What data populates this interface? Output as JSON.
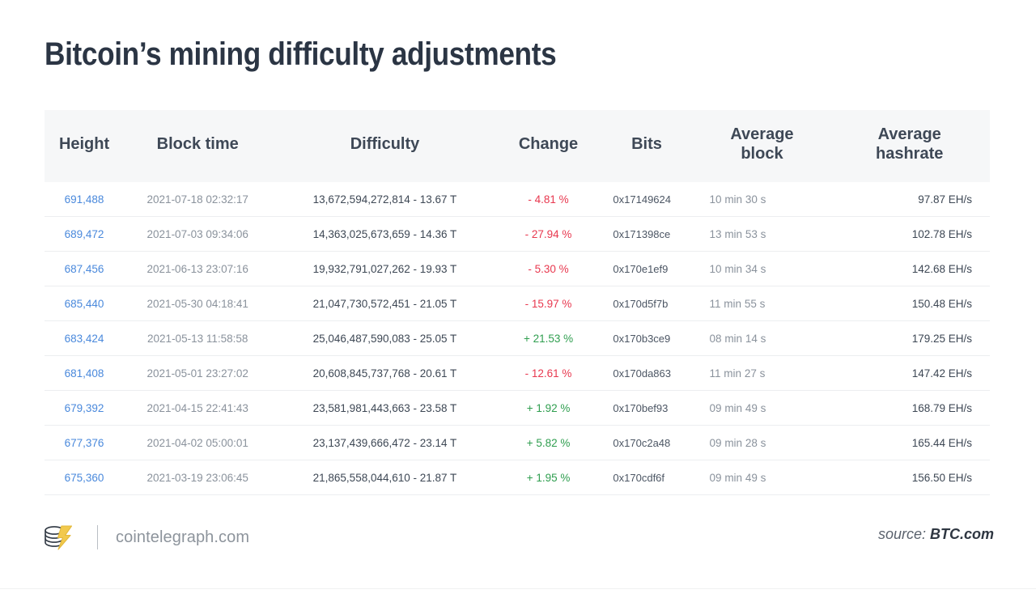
{
  "title": "Bitcoin’s mining difficulty adjustments",
  "colors": {
    "positive": "#2f9e4f",
    "negative": "#e8384f",
    "link": "#4a89dc",
    "header_bg": "#f6f7f8",
    "text": "#3d4754",
    "muted": "#8a929c",
    "logo_bolt": "#f2c94c"
  },
  "table": {
    "columns": [
      {
        "key": "height",
        "label": "Height"
      },
      {
        "key": "time",
        "label": "Block time"
      },
      {
        "key": "diff",
        "label": "Difficulty"
      },
      {
        "key": "change",
        "label": "Change"
      },
      {
        "key": "bits",
        "label": "Bits"
      },
      {
        "key": "avgblock",
        "label": "Average\nblock"
      },
      {
        "key": "hashrate",
        "label": "Average\nhashrate"
      }
    ],
    "column_labels": {
      "height": "Height",
      "time": "Block time",
      "difficulty": "Difficulty",
      "change": "Change",
      "bits": "Bits",
      "average_block_line1": "Average",
      "average_block_line2": "block",
      "average_hashrate_line1": "Average",
      "average_hashrate_line2": "hashrate"
    },
    "rows": [
      {
        "height": "691,488",
        "time": "2021-07-18 02:32:17",
        "difficulty": "13,672,594,272,814 - 13.67 T",
        "change": "- 4.81 %",
        "change_sign": "neg",
        "bits": "0x17149624",
        "average_block": "10 min 30 s",
        "average_hashrate": "97.87 EH/s"
      },
      {
        "height": "689,472",
        "time": "2021-07-03 09:34:06",
        "difficulty": "14,363,025,673,659 - 14.36 T",
        "change": "- 27.94 %",
        "change_sign": "neg",
        "bits": "0x171398ce",
        "average_block": "13 min 53 s",
        "average_hashrate": "102.78 EH/s"
      },
      {
        "height": "687,456",
        "time": "2021-06-13 23:07:16",
        "difficulty": "19,932,791,027,262 - 19.93 T",
        "change": "- 5.30 %",
        "change_sign": "neg",
        "bits": "0x170e1ef9",
        "average_block": "10 min 34 s",
        "average_hashrate": "142.68 EH/s"
      },
      {
        "height": "685,440",
        "time": "2021-05-30 04:18:41",
        "difficulty": "21,047,730,572,451 - 21.05 T",
        "change": "- 15.97 %",
        "change_sign": "neg",
        "bits": "0x170d5f7b",
        "average_block": "11 min 55 s",
        "average_hashrate": "150.48 EH/s"
      },
      {
        "height": "683,424",
        "time": "2021-05-13 11:58:58",
        "difficulty": "25,046,487,590,083 - 25.05 T",
        "change": "+ 21.53 %",
        "change_sign": "pos",
        "bits": "0x170b3ce9",
        "average_block": "08 min 14 s",
        "average_hashrate": "179.25 EH/s"
      },
      {
        "height": "681,408",
        "time": "2021-05-01 23:27:02",
        "difficulty": "20,608,845,737,768 - 20.61 T",
        "change": "- 12.61 %",
        "change_sign": "neg",
        "bits": "0x170da863",
        "average_block": "11 min 27 s",
        "average_hashrate": "147.42 EH/s"
      },
      {
        "height": "679,392",
        "time": "2021-04-15 22:41:43",
        "difficulty": "23,581,981,443,663 - 23.58 T",
        "change": "+ 1.92 %",
        "change_sign": "pos",
        "bits": "0x170bef93",
        "average_block": "09 min 49 s",
        "average_hashrate": "168.79 EH/s"
      },
      {
        "height": "677,376",
        "time": "2021-04-02 05:00:01",
        "difficulty": "23,137,439,666,472 - 23.14 T",
        "change": "+ 5.82 %",
        "change_sign": "pos",
        "bits": "0x170c2a48",
        "average_block": "09 min 28 s",
        "average_hashrate": "165.44 EH/s"
      },
      {
        "height": "675,360",
        "time": "2021-03-19 23:06:45",
        "difficulty": "21,865,558,044,610 - 21.87 T",
        "change": "+ 1.95 %",
        "change_sign": "pos",
        "bits": "0x170cdf6f",
        "average_block": "09 min 49 s",
        "average_hashrate": "156.50 EH/s"
      }
    ]
  },
  "footer": {
    "logo_icon": "coin-stack-lightning-icon",
    "brand_name": "cointelegraph.com",
    "source_label": "source:",
    "source_value": "BTC.com"
  },
  "chart_data": {
    "type": "table",
    "title": "Bitcoin’s mining difficulty adjustments",
    "columns": [
      "Height",
      "Block time",
      "Difficulty",
      "Change",
      "Bits",
      "Average block",
      "Average hashrate"
    ],
    "rows": [
      [
        "691,488",
        "2021-07-18 02:32:17",
        "13,672,594,272,814 - 13.67 T",
        "- 4.81 %",
        "0x17149624",
        "10 min 30 s",
        "97.87 EH/s"
      ],
      [
        "689,472",
        "2021-07-03 09:34:06",
        "14,363,025,673,659 - 14.36 T",
        "- 27.94 %",
        "0x171398ce",
        "13 min 53 s",
        "102.78 EH/s"
      ],
      [
        "687,456",
        "2021-06-13 23:07:16",
        "19,932,791,027,262 - 19.93 T",
        "- 5.30 %",
        "0x170e1ef9",
        "10 min 34 s",
        "142.68 EH/s"
      ],
      [
        "685,440",
        "2021-05-30 04:18:41",
        "21,047,730,572,451 - 21.05 T",
        "- 15.97 %",
        "0x170d5f7b",
        "11 min 55 s",
        "150.48 EH/s"
      ],
      [
        "683,424",
        "2021-05-13 11:58:58",
        "25,046,487,590,083 - 25.05 T",
        "+ 21.53 %",
        "0x170b3ce9",
        "08 min 14 s",
        "179.25 EH/s"
      ],
      [
        "681,408",
        "2021-05-01 23:27:02",
        "20,608,845,737,768 - 20.61 T",
        "- 12.61 %",
        "0x170da863",
        "11 min 27 s",
        "147.42 EH/s"
      ],
      [
        "679,392",
        "2021-04-15 22:41:43",
        "23,581,981,443,663 - 23.58 T",
        "+ 1.92 %",
        "0x170bef93",
        "09 min 49 s",
        "168.79 EH/s"
      ],
      [
        "677,376",
        "2021-04-02 05:00:01",
        "23,137,439,666,472 - 23.14 T",
        "+ 5.82 %",
        "0x170c2a48",
        "09 min 28 s",
        "165.44 EH/s"
      ],
      [
        "675,360",
        "2021-03-19 23:06:45",
        "21,865,558,044,610 - 21.87 T",
        "+ 1.95 %",
        "0x170cdf6f",
        "09 min 49 s",
        "156.50 EH/s"
      ]
    ],
    "difficulty_T": [
      13.67,
      14.36,
      19.93,
      21.05,
      25.05,
      20.61,
      23.58,
      23.14,
      21.87
    ],
    "change_pct": [
      -4.81,
      -27.94,
      -5.3,
      -15.97,
      21.53,
      -12.61,
      1.92,
      5.82,
      1.95
    ],
    "hashrate_EHs": [
      97.87,
      102.78,
      142.68,
      150.48,
      179.25,
      147.42,
      168.79,
      165.44,
      156.5
    ],
    "source": "BTC.com"
  }
}
